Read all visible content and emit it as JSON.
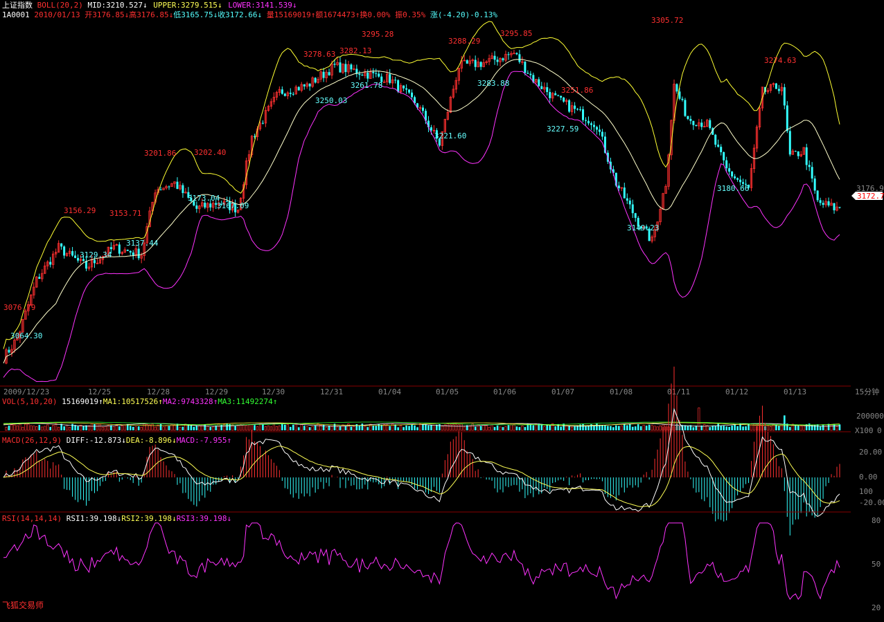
{
  "header": {
    "index_name": "上证指数",
    "boll_label": "BOLL(20,2)",
    "mid": "MID:3210.527",
    "upper": "UPPER:3279.515",
    "lower": "LOWER:3141.539",
    "code": "1A0001",
    "date": "2010/01/13",
    "open": "开3176.85",
    "high": "高3176.85",
    "low": "低3165.75",
    "close": "收3172.66",
    "volume": "量15169019",
    "amount": "额1674473",
    "turnover": "换0.00%",
    "amplitude": "振0.35%",
    "change": "涨(-4.20)-0.13%"
  },
  "vol_header": {
    "label": "VOL(5,10,20)",
    "value": "15169019",
    "ma1": "MA1:10517526",
    "ma2": "MA2:9743328",
    "ma3": "MA3:11492274"
  },
  "macd_header": {
    "label": "MACD(26,12,9)",
    "diff": "DIFF:-12.873",
    "dea": "DEA:-8.896",
    "macd": "MACD:-7.955"
  },
  "rsi_header": {
    "label": "RSI(14,14,14)",
    "rsi1": "RSI1:39.198",
    "rsi2": "RSI2:39.198",
    "rsi3": "RSI3:39.198"
  },
  "footer": {
    "brand": "飞狐交易师"
  },
  "colors": {
    "up": "#ff3030",
    "down": "#33ffff",
    "mid": "#ffffcc",
    "upper": "#ffff33",
    "lower": "#ff33ff",
    "ma1": "#ffffff",
    "ma2": "#ffff33",
    "ma3": "#33ff33",
    "grid": "#880000",
    "axis_text": "#888888"
  },
  "chart_data": {
    "type": "candlestick",
    "interval_label": "15分钟",
    "date_labels": [
      "2009/12/23",
      "12/25",
      "12/28",
      "12/29",
      "12/30",
      "12/31",
      "01/04",
      "01/05",
      "01/06",
      "01/07",
      "01/08",
      "01/11",
      "01/12",
      "01/13"
    ],
    "price_axis": {
      "ticks": [
        "3176.9"
      ],
      "current_label": "3172.7",
      "ylim": [
        3040,
        3320
      ]
    },
    "annotations_high": [
      "3076.79",
      "3156.29",
      "3153.71",
      "3201.86",
      "3202.40",
      "3278.63",
      "3282.13",
      "3295.28",
      "3288.29",
      "3295.85",
      "3251.86",
      "3305.72",
      "3274.63"
    ],
    "annotations_low": [
      "3064.30",
      "3129.34",
      "3137.44",
      "3173.04",
      "3167.09",
      "3250.03",
      "3261.78",
      "3221.60",
      "3283.88",
      "3227.59",
      "3149.23",
      "3180.66"
    ],
    "anchors": [
      {
        "i": 0,
        "v": 3060
      },
      {
        "i": 5,
        "v": 3075
      },
      {
        "i": 12,
        "v": 3120
      },
      {
        "i": 20,
        "v": 3145
      },
      {
        "i": 30,
        "v": 3130
      },
      {
        "i": 40,
        "v": 3145
      },
      {
        "i": 50,
        "v": 3140
      },
      {
        "i": 55,
        "v": 3190
      },
      {
        "i": 62,
        "v": 3195
      },
      {
        "i": 70,
        "v": 3175
      },
      {
        "i": 78,
        "v": 3180
      },
      {
        "i": 85,
        "v": 3175
      },
      {
        "i": 90,
        "v": 3230
      },
      {
        "i": 100,
        "v": 3265
      },
      {
        "i": 110,
        "v": 3270
      },
      {
        "i": 120,
        "v": 3285
      },
      {
        "i": 130,
        "v": 3280
      },
      {
        "i": 140,
        "v": 3275
      },
      {
        "i": 150,
        "v": 3255
      },
      {
        "i": 158,
        "v": 3225
      },
      {
        "i": 165,
        "v": 3285
      },
      {
        "i": 175,
        "v": 3288
      },
      {
        "i": 185,
        "v": 3295
      },
      {
        "i": 192,
        "v": 3275
      },
      {
        "i": 200,
        "v": 3260
      },
      {
        "i": 208,
        "v": 3250
      },
      {
        "i": 215,
        "v": 3240
      },
      {
        "i": 222,
        "v": 3195
      },
      {
        "i": 230,
        "v": 3165
      },
      {
        "i": 235,
        "v": 3150
      },
      {
        "i": 240,
        "v": 3195
      },
      {
        "i": 243,
        "v": 3270
      },
      {
        "i": 248,
        "v": 3245
      },
      {
        "i": 255,
        "v": 3240
      },
      {
        "i": 262,
        "v": 3205
      },
      {
        "i": 270,
        "v": 3190
      },
      {
        "i": 275,
        "v": 3265
      },
      {
        "i": 282,
        "v": 3270
      },
      {
        "i": 285,
        "v": 3215
      },
      {
        "i": 290,
        "v": 3220
      },
      {
        "i": 295,
        "v": 3180
      },
      {
        "i": 302,
        "v": 3175
      }
    ],
    "volume_axis": {
      "ticks": [
        "200000",
        "0"
      ],
      "unit": "X100"
    },
    "macd_axis": {
      "ticks": [
        "20.00",
        "0.00",
        "100",
        "-20.00"
      ]
    },
    "rsi_axis": {
      "ticks": [
        "80",
        "50",
        "20"
      ]
    }
  }
}
